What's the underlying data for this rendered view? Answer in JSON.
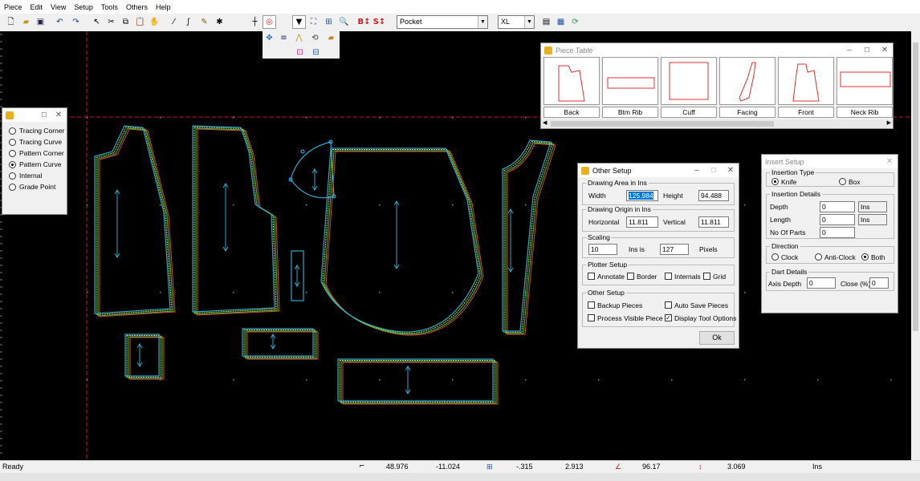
{
  "menu": [
    "Piece",
    "Edit",
    "View",
    "Setup",
    "Tools",
    "Others",
    "Help"
  ],
  "toolbar": {
    "piece_combo": "Pocket",
    "size_combo": "XL",
    "icons": [
      "new-icon",
      "open-icon",
      "save-icon",
      "undo-icon",
      "redo-icon",
      "pointer-icon",
      "cut-icon",
      "copy-icon",
      "paste-icon",
      "hand-icon",
      "line-tool-icon",
      "curve-tool-icon",
      "pencil-tool-icon",
      "star-tool-icon",
      "blank-tool-icon",
      "crosshair-icon",
      "target-icon",
      "notch-icon",
      "marker-icon",
      "measure-icon",
      "zoom-icon",
      "grade-b-icon",
      "grade-s-icon",
      "properties-icon",
      "calculator-icon",
      "refresh-icon"
    ]
  },
  "subtoolbar": {
    "icons": [
      "move-icon",
      "align-icon",
      "mirror-icon",
      "rotate-icon",
      "fold-icon",
      "piece-add-icon",
      "piece-flip-icon"
    ]
  },
  "point_panel": {
    "options": [
      {
        "label": "Tracing Corner",
        "selected": false
      },
      {
        "label": "Tracing Curve",
        "selected": false
      },
      {
        "label": "Pattern Corner",
        "selected": false
      },
      {
        "label": "Pattern Curve",
        "selected": true
      },
      {
        "label": "Internal",
        "selected": false
      },
      {
        "label": "Grade Point",
        "selected": false
      }
    ]
  },
  "piece_table": {
    "title": "Piece Table",
    "pieces": [
      "Back",
      "Btm Rib",
      "Cuff",
      "Facing",
      "Front",
      "Neck Rib"
    ]
  },
  "other_setup": {
    "title": "Other Setup",
    "drawing_area_label": "Drawing Area in Ins",
    "width_label": "Width",
    "width_value": "125.984",
    "height_label": "Height",
    "height_value": "94.488",
    "origin_label": "Drawing Origin in Ins",
    "horizontal_label": "Horizontal",
    "horizontal_value": "11.811",
    "vertical_label": "Vertical",
    "vertical_value": "11.811",
    "scaling_label": "Scaling",
    "scaling_value": "10",
    "ins_is_label": "Ins is",
    "pixels_value": "127",
    "pixels_label": "Pixels",
    "plotter_label": "Plotter Setup",
    "annotate_label": "Annotate",
    "border_label": "Border",
    "internals_label": "Internals",
    "grid_label": "Grid",
    "other_setup_group_label": "Other Setup",
    "backup_label": "Backup Pieces",
    "autosave_label": "Auto Save Pieces",
    "process_label": "Process Visible Piece",
    "display_tool_label": "Display Tool Options",
    "display_tool_checked": true,
    "ok_label": "Ok"
  },
  "insert_setup": {
    "title": "Insert Setup",
    "type_label": "Insertion Type",
    "knife_label": "Knife",
    "box_label": "Box",
    "details_label": "Insertion Details",
    "depth_label": "Depth",
    "depth_value": "0",
    "depth_unit": "Ins",
    "length_label": "Length",
    "length_value": "0",
    "length_unit": "Ins",
    "parts_label": "No Of Parts",
    "parts_value": "0",
    "direction_label": "Direction",
    "clock_label": "Clock",
    "anticlock_label": "Anti-Clock",
    "both_label": "Both",
    "dart_label": "Dart Details",
    "axis_depth_label": "Axis Depth",
    "axis_depth_value": "0",
    "close_label": "Close (%)",
    "close_value": "0"
  },
  "status": {
    "ready": "Ready",
    "x": "48.976",
    "y": "-11.024",
    "dx": "-.315",
    "dy": "2.913",
    "angle": "96.17",
    "length": "3.069",
    "unit": "Ins"
  },
  "colors": {
    "canvas": "#000000",
    "piece_outline": "#2fa8c8",
    "grade_yellow": "#d8e020",
    "grade_green": "#40c040",
    "grade_red": "#e04040",
    "guide_red": "#c02020"
  }
}
